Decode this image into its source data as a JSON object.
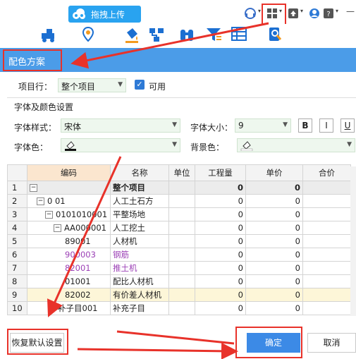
{
  "topbar": {
    "upload_label": "拖拽上传"
  },
  "dialog": {
    "title": "配色方案",
    "project_row_label": "项目行：",
    "project_row_value": "整个项目",
    "enabled_label": "可用",
    "font_section_title": "字体及颜色设置",
    "font_style_label": "字体样式：",
    "font_style_value": "宋体",
    "font_size_label": "字体大小：",
    "font_size_value": "9",
    "bold_label": "B",
    "italic_label": "I",
    "underline_label": "U",
    "font_color_label": "字体色：",
    "bg_color_label": "背景色："
  },
  "grid": {
    "headers": [
      "编码",
      "名称",
      "单位",
      "工程量",
      "单价",
      "合价"
    ],
    "rows": [
      {
        "n": "1",
        "code": "",
        "name": "整个项目",
        "unit": "",
        "qty": "0",
        "price": "0",
        "color": "#222"
      },
      {
        "n": "2",
        "code": "0 01",
        "name": "人工土石方",
        "unit": "",
        "qty": "0",
        "price": "0",
        "color": "#222"
      },
      {
        "n": "3",
        "code": "0101010001",
        "name": "平整场地",
        "unit": "",
        "qty": "0",
        "price": "0",
        "color": "#222"
      },
      {
        "n": "4",
        "code": "AA000001",
        "name": "人工挖土",
        "unit": "",
        "qty": "0",
        "price": "0",
        "color": "#222"
      },
      {
        "n": "5",
        "code": "89001",
        "name": "人材机",
        "unit": "",
        "qty": "0",
        "price": "0",
        "color": "#222"
      },
      {
        "n": "6",
        "code": "900003",
        "name": "钢筋",
        "unit": "",
        "qty": "0",
        "price": "0",
        "color": "#9b3fb5"
      },
      {
        "n": "7",
        "code": "82001",
        "name": "推土机",
        "unit": "",
        "qty": "0",
        "price": "0",
        "color": "#9b3fb5"
      },
      {
        "n": "8",
        "code": "01001",
        "name": "配比人材机",
        "unit": "",
        "qty": "0",
        "price": "0",
        "color": "#222"
      },
      {
        "n": "9",
        "code": "82002",
        "name": "有价差人材机",
        "unit": "",
        "qty": "0",
        "price": "0",
        "color": "#222"
      },
      {
        "n": "10",
        "code": "补子目001",
        "name": "补充子目",
        "unit": "",
        "qty": "0",
        "price": "0",
        "color": "#222"
      }
    ]
  },
  "buttons": {
    "restore_default": "恢复默认设置",
    "ok": "确定",
    "cancel": "取消"
  }
}
